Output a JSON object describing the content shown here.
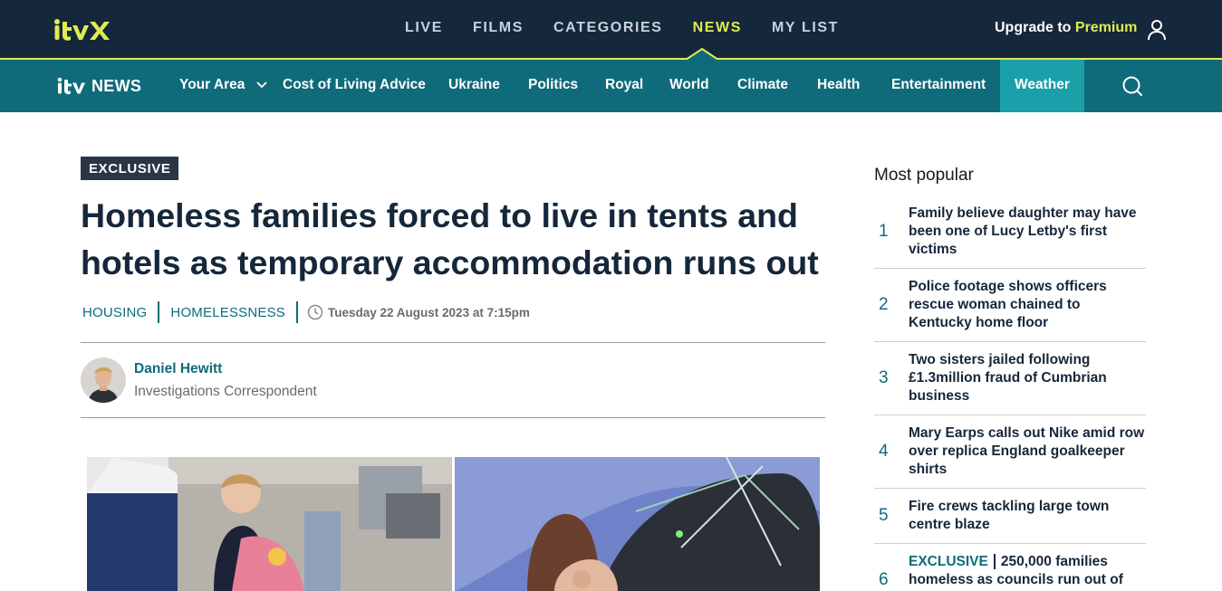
{
  "topbar": {
    "logo": "itvX",
    "nav": [
      "LIVE",
      "FILMS",
      "CATEGORIES",
      "NEWS",
      "MY LIST"
    ],
    "active_nav": "NEWS",
    "upgrade_prefix": "Upgrade to",
    "upgrade_premium": "Premium",
    "accent": "#deeb52",
    "bg": "#15273a"
  },
  "subnav": {
    "logo_text": "NEWS",
    "items": {
      "your_area": "Your Area",
      "cost": "Cost of Living Advice",
      "ukraine": "Ukraine",
      "politics": "Politics",
      "royal": "Royal",
      "world": "World",
      "climate": "Climate",
      "health": "Health",
      "entertainment": "Entertainment",
      "weather": "Weather"
    },
    "bg": "#0f6b7a",
    "highlight": "#1aa0a8"
  },
  "article": {
    "badge": "EXCLUSIVE",
    "headline": "Homeless families forced to live in tents and hotels as temporary accommodation runs out",
    "tags": [
      "HOUSING",
      "HOMELESSNESS"
    ],
    "date": "Tuesday 22 August 2023 at 7:15pm",
    "author_name": "Daniel Hewitt",
    "author_role": "Investigations Correspondent"
  },
  "sidebar": {
    "title": "Most popular",
    "items": [
      {
        "num": "1",
        "text": "Family believe daughter may have been one of Lucy Letby's first victims"
      },
      {
        "num": "2",
        "text": "Police footage shows officers rescue woman chained to Kentucky home floor"
      },
      {
        "num": "3",
        "text": "Two sisters jailed following £1.3million fraud of Cumbrian business"
      },
      {
        "num": "4",
        "text": "Mary Earps calls out Nike amid row over replica England goalkeeper shirts"
      },
      {
        "num": "5",
        "text": "Fire crews tackling large town centre blaze"
      },
      {
        "num": "6",
        "prefix": "EXCLUSIVE",
        "text": "250,000 families homeless as councils run out of"
      }
    ]
  }
}
